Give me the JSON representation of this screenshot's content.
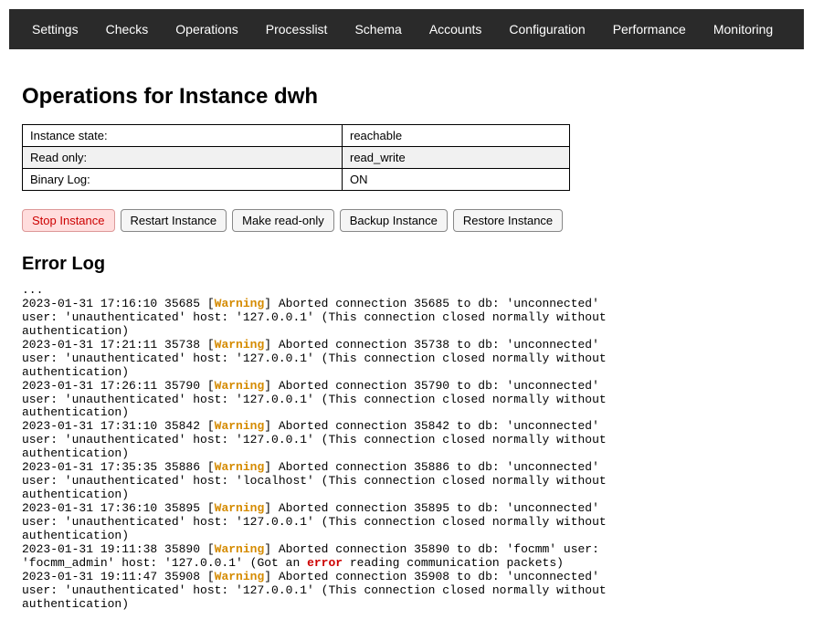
{
  "nav": {
    "items": [
      {
        "label": "Settings"
      },
      {
        "label": "Checks"
      },
      {
        "label": "Operations"
      },
      {
        "label": "Processlist"
      },
      {
        "label": "Schema"
      },
      {
        "label": "Accounts"
      },
      {
        "label": "Configuration"
      },
      {
        "label": "Performance"
      },
      {
        "label": "Monitoring"
      }
    ]
  },
  "page": {
    "title": "Operations for Instance dwh",
    "error_log_title": "Error Log"
  },
  "info_rows": [
    {
      "label": "Instance state:",
      "value": "reachable"
    },
    {
      "label": "Read only:",
      "value": "read_write"
    },
    {
      "label": "Binary Log:",
      "value": "ON"
    }
  ],
  "buttons": [
    {
      "label": "Stop Instance",
      "danger": true
    },
    {
      "label": "Restart Instance"
    },
    {
      "label": "Make read-only"
    },
    {
      "label": "Backup Instance"
    },
    {
      "label": "Restore Instance"
    }
  ],
  "log": {
    "prefix": "...",
    "entries": [
      {
        "ts": "2023-01-31 17:16:10",
        "id": "35685",
        "severity": "Warning",
        "msg": "Aborted connection 35685 to db: 'unconnected' user: 'unauthenticated' host: '127.0.0.1' (This connection closed normally without authentication)"
      },
      {
        "ts": "2023-01-31 17:21:11",
        "id": "35738",
        "severity": "Warning",
        "msg": "Aborted connection 35738 to db: 'unconnected' user: 'unauthenticated' host: '127.0.0.1' (This connection closed normally without authentication)"
      },
      {
        "ts": "2023-01-31 17:26:11",
        "id": "35790",
        "severity": "Warning",
        "msg": "Aborted connection 35790 to db: 'unconnected' user: 'unauthenticated' host: '127.0.0.1' (This connection closed normally without authentication)"
      },
      {
        "ts": "2023-01-31 17:31:10",
        "id": "35842",
        "severity": "Warning",
        "msg": "Aborted connection 35842 to db: 'unconnected' user: 'unauthenticated' host: '127.0.0.1' (This connection closed normally without authentication)"
      },
      {
        "ts": "2023-01-31 17:35:35",
        "id": "35886",
        "severity": "Warning",
        "msg": "Aborted connection 35886 to db: 'unconnected' user: 'unauthenticated' host: 'localhost' (This connection closed normally without authentication)"
      },
      {
        "ts": "2023-01-31 17:36:10",
        "id": "35895",
        "severity": "Warning",
        "msg": "Aborted connection 35895 to db: 'unconnected' user: 'unauthenticated' host: '127.0.0.1' (This connection closed normally without authentication)"
      },
      {
        "ts": "2023-01-31 19:11:38",
        "id": "35890",
        "severity": "Warning",
        "msg": "Aborted connection 35890 to db: 'focmm' user: 'focmm_admin' host: '127.0.0.1' (Got an error reading communication packets)"
      },
      {
        "ts": "2023-01-31 19:11:47",
        "id": "35908",
        "severity": "Warning",
        "msg": "Aborted connection 35908 to db: 'unconnected' user: 'unauthenticated' host: '127.0.0.1' (This connection closed normally without authentication)"
      }
    ]
  }
}
